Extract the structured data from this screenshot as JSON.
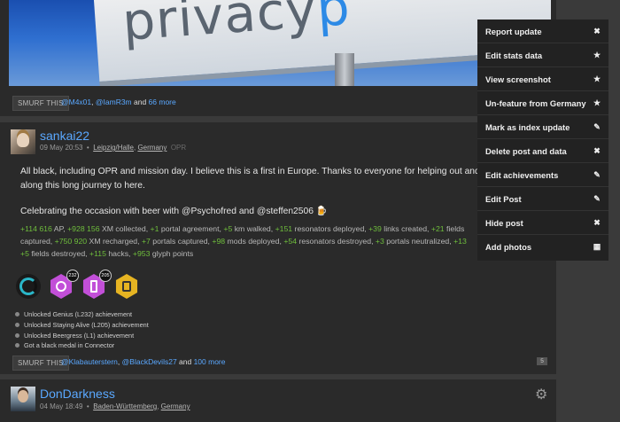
{
  "post1": {
    "smurf_label": "SMURF THIS",
    "likers": [
      "@M4x01",
      "@IamR3m"
    ],
    "likes_more": "66 more",
    "banner_text_a": "privacy",
    "banner_text_b": "p"
  },
  "post2": {
    "username": "sankai22",
    "date": "09 May 20:53",
    "location_city": "Leipzig/Halle",
    "location_country": "Germany",
    "opr": "OPR",
    "body_line1": "All black, including OPR and mission day. I believe this is a first in Europe. Thanks to everyone for helping out and to e",
    "body_line2": "along this long journey to here.",
    "body_line3": "Celebrating the occasion with beer with @Psychofred and @steffen2506 🍺",
    "stats": [
      {
        "v": "+114 616",
        "t": " AP, "
      },
      {
        "v": "+928 156",
        "t": " XM collected, "
      },
      {
        "v": "+1",
        "t": " portal agreement, "
      },
      {
        "v": "+5",
        "t": " km walked, "
      },
      {
        "v": "+151",
        "t": " resonators deployed, "
      },
      {
        "v": "+39",
        "t": " links created, "
      },
      {
        "v": "+21",
        "t": " fields"
      }
    ],
    "stats2": [
      {
        "v": "",
        "t": "captured, "
      },
      {
        "v": "+750 920",
        "t": " XM recharged, "
      },
      {
        "v": "+7",
        "t": " portals captured, "
      },
      {
        "v": "+98",
        "t": " mods deployed, "
      },
      {
        "v": "+54",
        "t": " resonators destroyed, "
      },
      {
        "v": "+3",
        "t": " portals neutralized, "
      },
      {
        "v": "+13",
        "t": ""
      }
    ],
    "stats3": [
      {
        "v": "+5",
        "t": " fields destroyed, "
      },
      {
        "v": "+115",
        "t": " hacks, "
      },
      {
        "v": "+953",
        "t": " glyph points"
      }
    ],
    "badge_counts": [
      "232",
      "205"
    ],
    "achievements": [
      "Unlocked Genius (L232) achievement",
      "Unlocked Staying Alive (L205) achievement",
      "Unlocked Beergress (L1) achievement",
      "Got a black medal in Connector"
    ],
    "smurf_label": "SMURF THIS",
    "likers": [
      "@Klabauterstern",
      "@BlackDevils27"
    ],
    "likes_more": "100 more",
    "comment_count": "5"
  },
  "post3": {
    "username": "DonDarkness",
    "date": "04 May 18:49",
    "location_region": "Baden-Württemberg",
    "location_country": "Germany"
  },
  "menu": [
    {
      "label": "Report update",
      "icon": "close-icon"
    },
    {
      "label": "Edit stats data",
      "icon": "star-icon"
    },
    {
      "label": "View screenshot",
      "icon": "star-icon"
    },
    {
      "label": "Un-feature from Germany",
      "icon": "star-icon"
    },
    {
      "label": "Mark as index update",
      "icon": "pencil-icon"
    },
    {
      "label": "Delete post and data",
      "icon": "close-icon"
    },
    {
      "label": "Edit achievements",
      "icon": "pencil-icon"
    },
    {
      "label": "Edit Post",
      "icon": "pencil-icon"
    },
    {
      "label": "Hide post",
      "icon": "close-icon"
    },
    {
      "label": "Add photos",
      "icon": "grid-icon"
    }
  ]
}
